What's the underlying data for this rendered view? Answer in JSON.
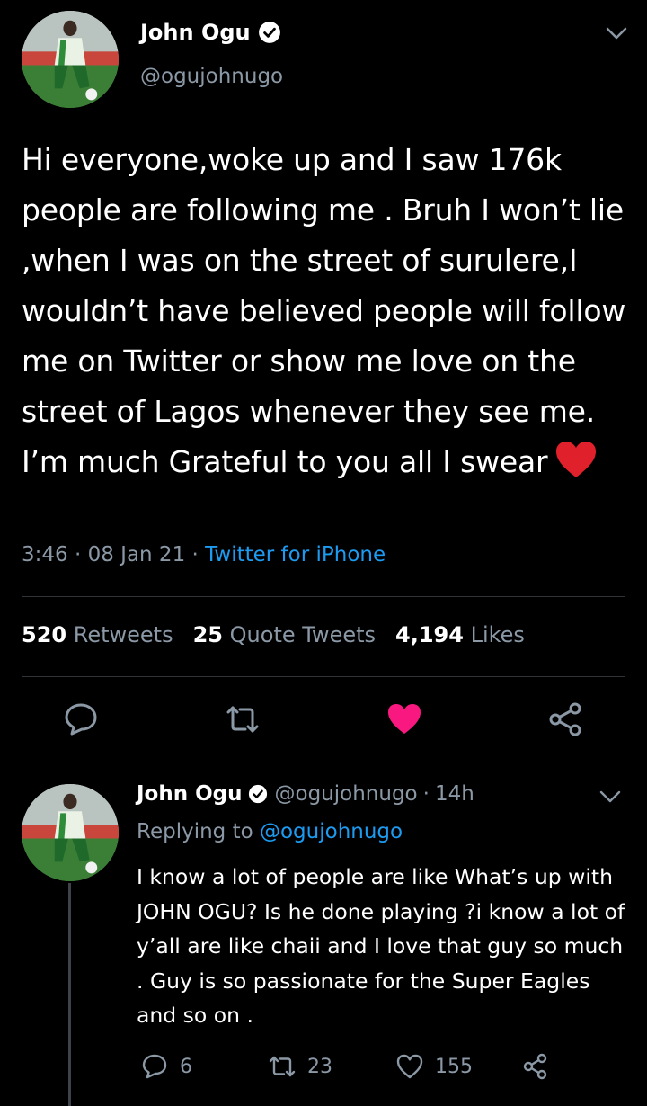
{
  "main_tweet": {
    "author_name": "John Ogu",
    "handle": "@ogujohnugo",
    "text": "Hi everyone,woke up and I saw 176k people are following me . Bruh I won’t lie ,when I was on the street of surulere,I wouldn’t have believed people will follow me on Twitter or show me love on the street of Lagos whenever they see me. I’m much Grateful to you all I swear",
    "emoji": "red-heart",
    "time": "3:46",
    "date": "08 Jan 21",
    "separator": "·",
    "source": "Twitter for iPhone",
    "stats": {
      "retweets_count": "520",
      "retweets_label": "Retweets",
      "quotes_count": "25",
      "quotes_label": "Quote Tweets",
      "likes_count": "4,194",
      "likes_label": "Likes"
    },
    "actions": [
      "reply-icon",
      "retweet-icon",
      "like-icon-filled",
      "share-icon"
    ],
    "liked": true
  },
  "reply_tweet": {
    "author_name": "John Ogu",
    "handle": "@ogujohnugo",
    "separator": "·",
    "time": "14h",
    "replying_label": "Replying to",
    "replying_to": "@ogujohnugo",
    "text": "I know a lot of people are like What’s up with JOHN OGU? Is he done playing ?i know a lot of y’all are like chaii and I love that guy so much . Guy is so passionate for the Super Eagles and so on .",
    "reply_count": "6",
    "retweet_count": "23",
    "like_count": "155"
  },
  "colors": {
    "background": "#000000",
    "secondary_text": "#8b98a5",
    "accent_blue": "#1d9bf0",
    "like_pink": "#f91880",
    "divider": "#2f3336"
  }
}
